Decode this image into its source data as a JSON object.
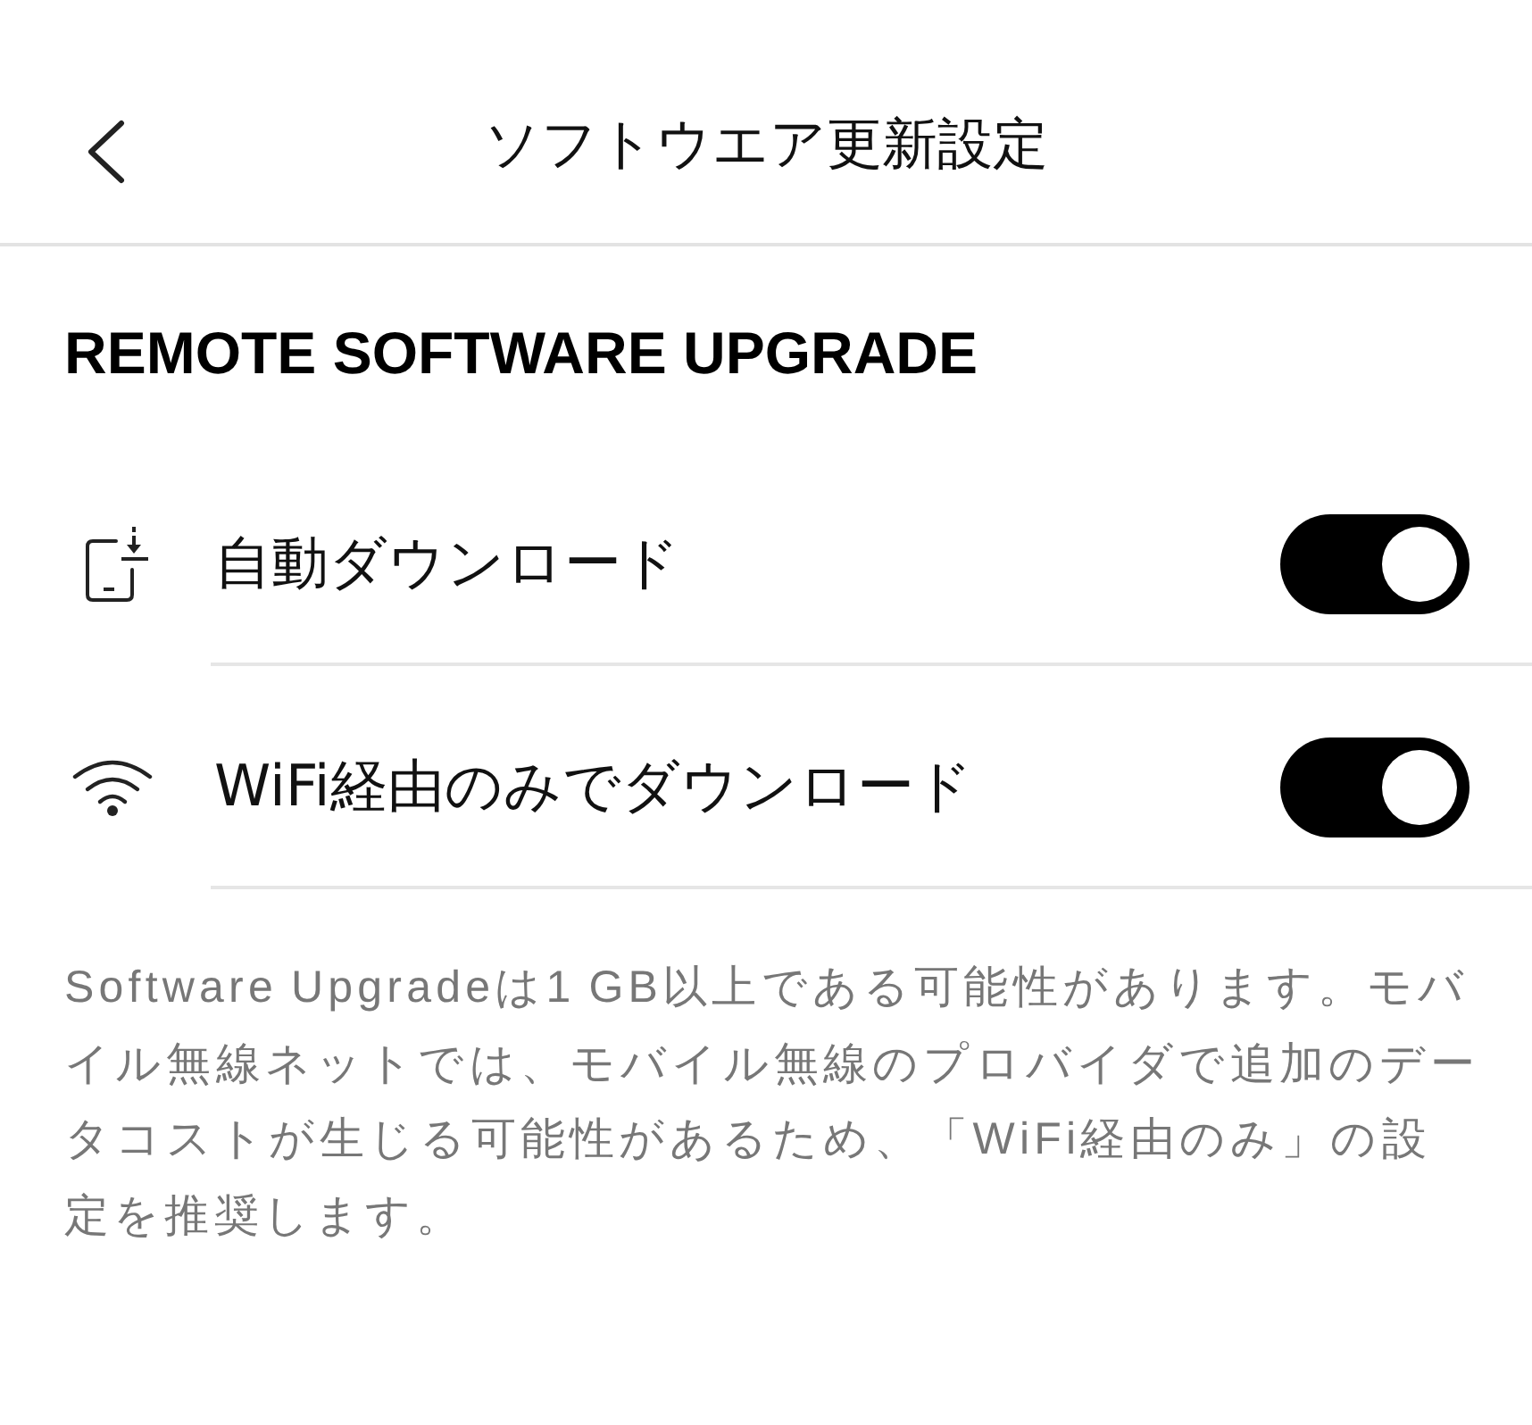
{
  "header": {
    "title": "ソフトウエア更新設定"
  },
  "section": {
    "heading": "REMOTE SOFTWARE UPGRADE"
  },
  "settings": [
    {
      "kind": "download",
      "label": "自動ダウンロード",
      "on": true
    },
    {
      "kind": "wifi",
      "label": "WiFi経由のみでダウンロード",
      "on": true
    }
  ],
  "note": "Software Upgradeは1 GB以上である可能性があります。モバイル無線ネットでは、モバイル無線のプロバイダで追加のデータコストが生じる可能性があるため、「WiFi経由のみ」の設定を推奨します。"
}
